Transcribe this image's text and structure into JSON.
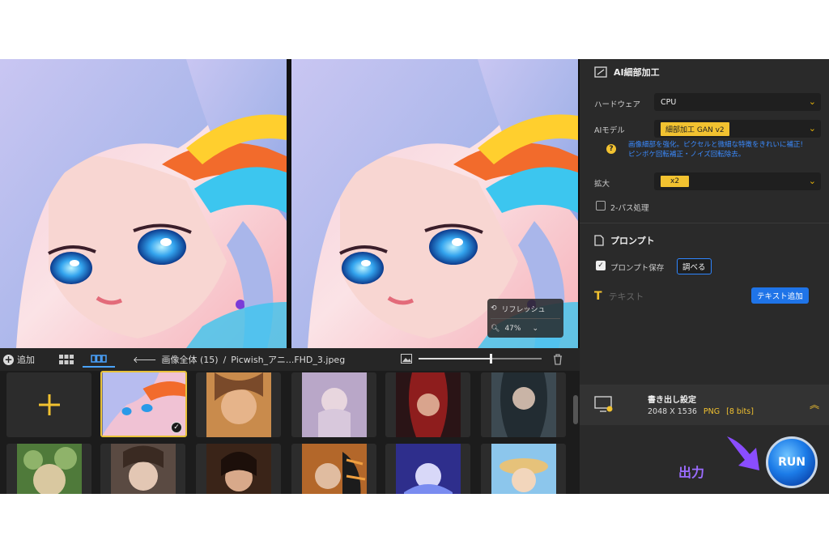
{
  "toolbar": {
    "add_label": "追加",
    "breadcrumb_all": "画像全体 (15)",
    "breadcrumb_sep": "/",
    "breadcrumb_file": "Picwish_アニ...FHD_3.jpeg"
  },
  "overlay": {
    "refresh_label": "リフレッシュ",
    "zoom_value": "47%"
  },
  "zoom_slider": {
    "value": 0.58
  },
  "panel": {
    "title": "AI細部加工",
    "hardware_label": "ハードウェア",
    "hardware_value": "CPU",
    "model_label": "AIモデル",
    "model_value": "細部加工 GAN v2",
    "model_hint_line1": "画像細部を強化。ピクセルと微細な特徴をきれいに補正!",
    "model_hint_line2": "ピンボケ回転補正・ノイズ回転除去。",
    "scale_label": "拡大",
    "scale_value": "x2",
    "twopass_label": "2-パス処理",
    "prompt_title": "プロンプト",
    "prompt_save_label": "プロンプト保存",
    "prompt_inspect_button": "調べる",
    "text_label": "テキスト",
    "add_text_button": "テキスト追加",
    "export_title": "書き出し設定",
    "export_size": "2048 X 1536",
    "export_format": "PNG",
    "export_bits": "[8 bits]",
    "output_label": "出力",
    "run_label": "RUN"
  },
  "colors": {
    "accent_yellow": "#f2c230",
    "accent_blue": "#1f74e8",
    "output_purple": "#9b6cff"
  }
}
